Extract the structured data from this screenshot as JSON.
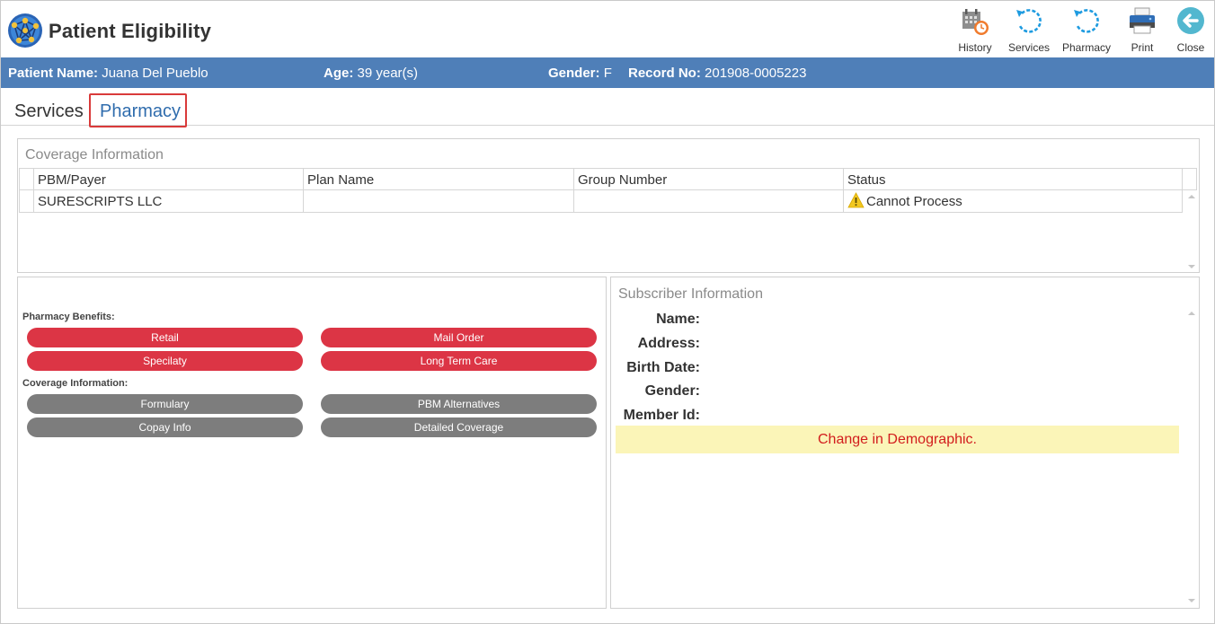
{
  "app": {
    "title": "Patient Eligibility",
    "logo_icon": "globe-network-logo"
  },
  "toolbar": [
    {
      "label": "History",
      "icon": "calendar-clock-icon"
    },
    {
      "label": "Services",
      "icon": "refresh-icon"
    },
    {
      "label": "Pharmacy",
      "icon": "refresh-icon"
    },
    {
      "label": "Print",
      "icon": "printer-icon"
    },
    {
      "label": "Close",
      "icon": "back-arrow-icon"
    }
  ],
  "patient": {
    "name_label": "Patient Name:",
    "name": "Juana Del Pueblo",
    "age_label": "Age:",
    "age": "39 year(s)",
    "gender_label": "Gender:",
    "gender": "F",
    "record_label": "Record No:",
    "record": "201908-0005223"
  },
  "tabs": [
    {
      "label": "Services",
      "active": false
    },
    {
      "label": "Pharmacy",
      "active": true
    }
  ],
  "coverage": {
    "title": "Coverage Information",
    "columns": [
      "PBM/Payer",
      "Plan Name",
      "Group Number",
      "Status"
    ],
    "rows": [
      {
        "payer": "SURESCRIPTS LLC",
        "plan": "",
        "group": "",
        "status": "Cannot Process",
        "status_icon": "warning-icon"
      }
    ]
  },
  "benefits": {
    "pharmacy_label": "Pharmacy Benefits:",
    "pharmacy_buttons": [
      "Retail",
      "Mail Order",
      "Specilaty",
      "Long Term Care"
    ],
    "coverage_label": "Coverage Information:",
    "coverage_buttons": [
      "Formulary",
      "PBM Alternatives",
      "Copay Info",
      "Detailed Coverage"
    ]
  },
  "subscriber": {
    "title": "Subscriber Information",
    "fields": [
      "Name:",
      "Address:",
      "Birth Date:",
      "Gender:",
      "Member Id:"
    ],
    "alert": "Change in Demographic."
  },
  "colors": {
    "patient_bar": "#4f7fb8",
    "tab_active": "#2f6cad",
    "tab_highlight": "#d93a3a",
    "button_red": "#dc3545",
    "button_grey": "#7d7d7d",
    "alert_bg": "#fbf5b8",
    "alert_text": "#d21d1d"
  }
}
